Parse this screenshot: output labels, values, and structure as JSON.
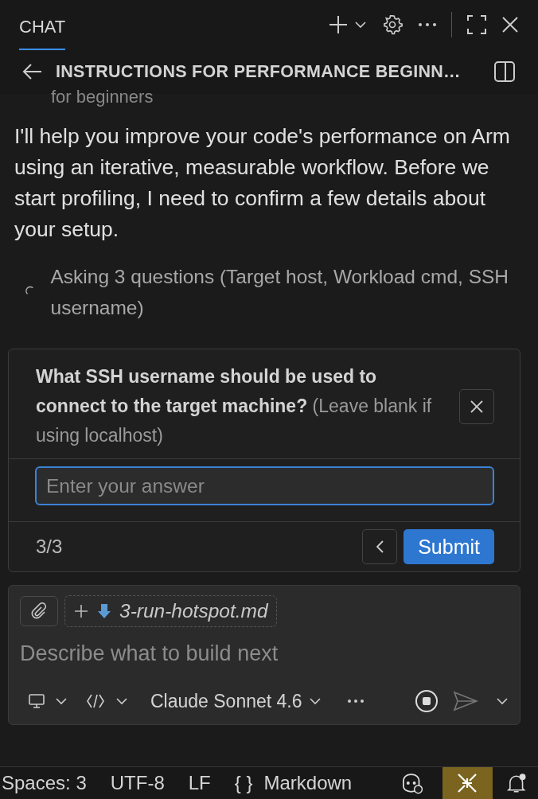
{
  "header": {
    "tab": {
      "label": "CHAT",
      "selected": true
    },
    "title": "INSTRUCTIONS FOR PERFORMANCE BEGINN…"
  },
  "chat": {
    "fragment": "for beginners",
    "message": "I'll help you improve your code's performance on Arm using an iterative, measurable workflow. Before we start profiling, I need to confirm a few details about your setup.",
    "progress": "Asking 3 questions (Target host, Workload cmd, SSH username)"
  },
  "question": {
    "prompt": "What SSH username should be used to connect to the target machine?",
    "hint": "(Leave blank if using localhost)",
    "input": {
      "placeholder": "Enter your answer",
      "focused": true
    },
    "counter": "3/3",
    "submit": "Submit"
  },
  "composer": {
    "attachment": "3-run-hotspot.md",
    "placeholder": "Describe what to build next",
    "model": "Claude Sonnet 4.6"
  },
  "status_bar": {
    "items": [
      {
        "kind": "text",
        "label": "Spaces: 3"
      },
      {
        "kind": "text",
        "label": "UTF-8"
      },
      {
        "kind": "text",
        "label": "LF"
      },
      {
        "kind": "language",
        "glyph": "{ }",
        "label": "Markdown"
      }
    ]
  }
}
